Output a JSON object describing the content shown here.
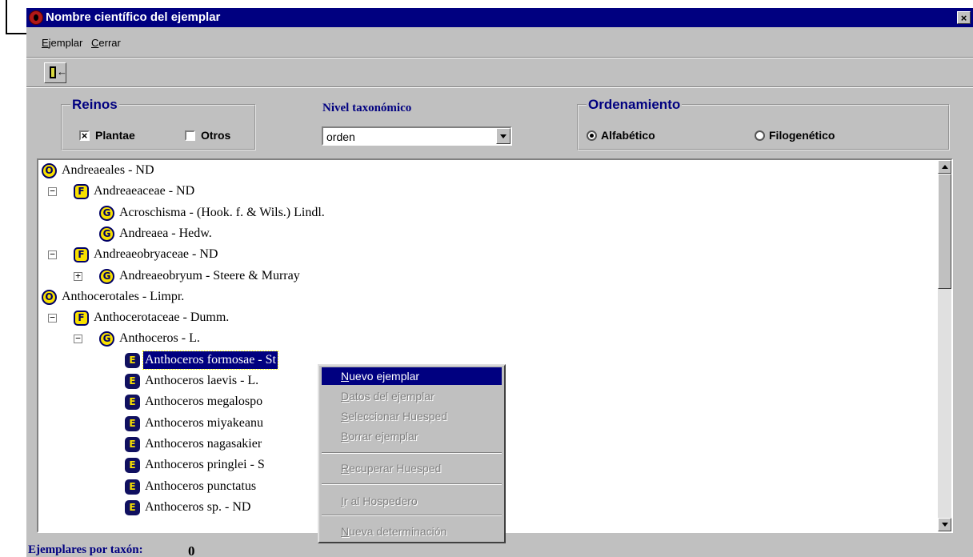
{
  "window": {
    "title": "Nombre científico del ejemplar",
    "close": "×"
  },
  "menu": {
    "ejemplar": "Ejemplar",
    "cerrar": "Cerrar"
  },
  "reinos": {
    "title": "Reinos",
    "plantae": "Plantae",
    "otros": "Otros",
    "plantae_checked": true,
    "otros_checked": false,
    "check_mark": "×"
  },
  "nivel": {
    "label": "Nivel taxonómico",
    "value": "orden"
  },
  "ordenamiento": {
    "title": "Ordenamiento",
    "alfabetico": "Alfabético",
    "filogenetico": "Filogenético",
    "selected": "Alfabético"
  },
  "tree": {
    "nodes": [
      {
        "level": "O",
        "label": "Andreaeales - ND",
        "expander": ""
      },
      {
        "level": "F",
        "label": "Andreaeaceae - ND",
        "expander": "−"
      },
      {
        "level": "G",
        "label": "Acroschisma - (Hook. f. & Wils.) Lindl.",
        "expander": ""
      },
      {
        "level": "G",
        "label": "Andreaea - Hedw.",
        "expander": ""
      },
      {
        "level": "F",
        "label": "Andreaeobryaceae - ND",
        "expander": "−"
      },
      {
        "level": "G",
        "label": "Andreaeobryum - Steere & Murray",
        "expander": "+"
      },
      {
        "level": "O",
        "label": "Anthocerotales - Limpr.",
        "expander": ""
      },
      {
        "level": "F",
        "label": "Anthocerotaceae - Dumm.",
        "expander": "−"
      },
      {
        "level": "G",
        "label": "Anthoceros - L.",
        "expander": "−"
      },
      {
        "level": "E",
        "label": "Anthoceros formosae - St",
        "expander": ""
      },
      {
        "level": "E",
        "label": "Anthoceros laevis - L.",
        "expander": ""
      },
      {
        "level": "E",
        "label": "Anthoceros megalospo",
        "expander": ""
      },
      {
        "level": "E",
        "label": "Anthoceros miyakeanu",
        "expander": ""
      },
      {
        "level": "E",
        "label": "Anthoceros nagasakier",
        "expander": ""
      },
      {
        "level": "E",
        "label": "Anthoceros pringlei - S",
        "expander": ""
      },
      {
        "level": "E",
        "label": "Anthoceros punctatus",
        "expander": ""
      },
      {
        "level": "E",
        "label": "Anthoceros sp. - ND",
        "expander": ""
      }
    ]
  },
  "context_menu": {
    "items": [
      {
        "label": "Nuevo ejemplar",
        "enabled": true
      },
      {
        "label": "Datos del ejemplar",
        "enabled": false
      },
      {
        "label": "Seleccionar Huesped",
        "enabled": false
      },
      {
        "label": "Borrar ejemplar",
        "enabled": false
      },
      {
        "label": "Recuperar Huesped",
        "enabled": false
      },
      {
        "label": "Ir al Hospedero",
        "enabled": false
      },
      {
        "label": "Nueva determinación",
        "enabled": false
      }
    ]
  },
  "status": {
    "label": "Ejemplares por taxón:",
    "value": "0"
  },
  "colors": {
    "title_bar": "#000080",
    "face": "#c0c0c0",
    "group_title": "#000080",
    "badge_fill": "#f8e000",
    "badge_outline": "#000066"
  }
}
